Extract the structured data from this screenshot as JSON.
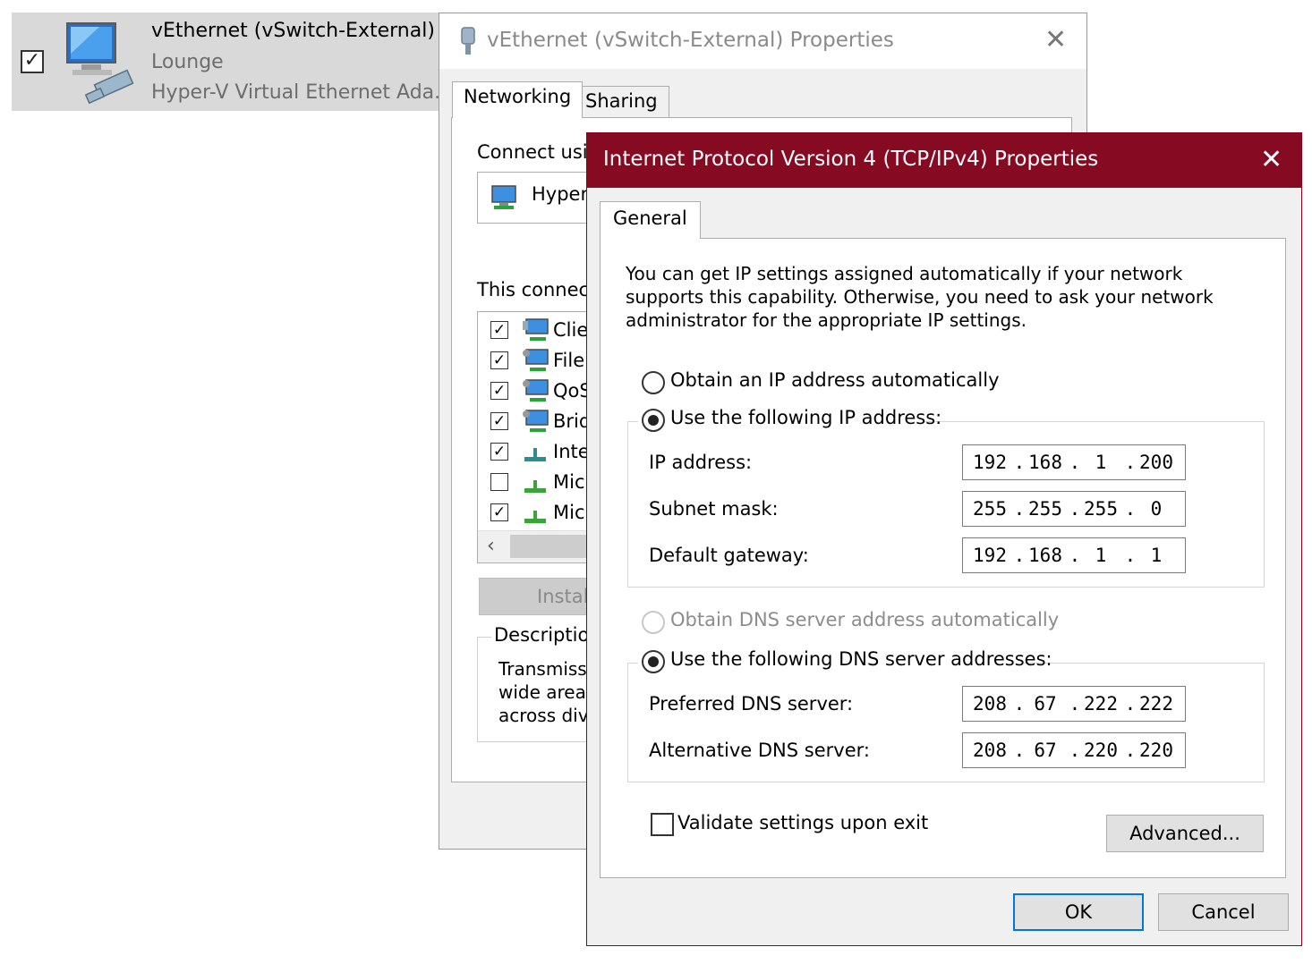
{
  "adapter": {
    "checked": true,
    "name": "vEthernet (vSwitch-External)",
    "network": "Lounge",
    "device": "Hyper-V Virtual Ethernet Ada..."
  },
  "properties_dialog": {
    "title": "vEthernet (vSwitch-External) Properties",
    "tabs": [
      "Networking",
      "Sharing"
    ],
    "connect_using_label": "Connect usin",
    "adapter_label": "Hyper-",
    "uses_label": "This connect",
    "items": [
      {
        "checked": true,
        "label": "Clie"
      },
      {
        "checked": true,
        "label": "File"
      },
      {
        "checked": true,
        "label": "QoS"
      },
      {
        "checked": true,
        "label": "Brid"
      },
      {
        "checked": true,
        "label": "Inte"
      },
      {
        "checked": false,
        "label": "Micr"
      },
      {
        "checked": true,
        "label": "Micr"
      }
    ],
    "install_label": "Install.",
    "description_label": "Description",
    "description_lines": [
      "Transmissi",
      "wide area",
      "across div"
    ]
  },
  "ipv4_dialog": {
    "title": "Internet Protocol Version 4 (TCP/IPv4) Properties",
    "tab": "General",
    "intro": "You can get IP settings assigned automatically if your network supports this capability. Otherwise, you need to ask your network administrator for the appropriate IP settings.",
    "ip_auto_label": "Obtain an IP address automatically",
    "ip_manual_label": "Use the following IP address:",
    "ip_mode": "manual",
    "ip_address_label": "IP address:",
    "ip_address": [
      "192",
      "168",
      "1",
      "200"
    ],
    "subnet_label": "Subnet mask:",
    "subnet_mask": [
      "255",
      "255",
      "255",
      "0"
    ],
    "gateway_label": "Default gateway:",
    "default_gateway": [
      "192",
      "168",
      "1",
      "1"
    ],
    "dns_auto_label": "Obtain DNS server address automatically",
    "dns_manual_label": "Use the following DNS server addresses:",
    "dns_mode": "manual",
    "preferred_dns_label": "Preferred DNS server:",
    "preferred_dns": [
      "208",
      "67",
      "222",
      "222"
    ],
    "alternative_dns_label": "Alternative DNS server:",
    "alternative_dns": [
      "208",
      "67",
      "220",
      "220"
    ],
    "validate_label": "Validate settings upon exit",
    "validate_checked": false,
    "advanced_label": "Advanced...",
    "ok_label": "OK",
    "cancel_label": "Cancel"
  },
  "colors": {
    "title_accent": "#870a23",
    "focus_border": "#0078d7"
  }
}
